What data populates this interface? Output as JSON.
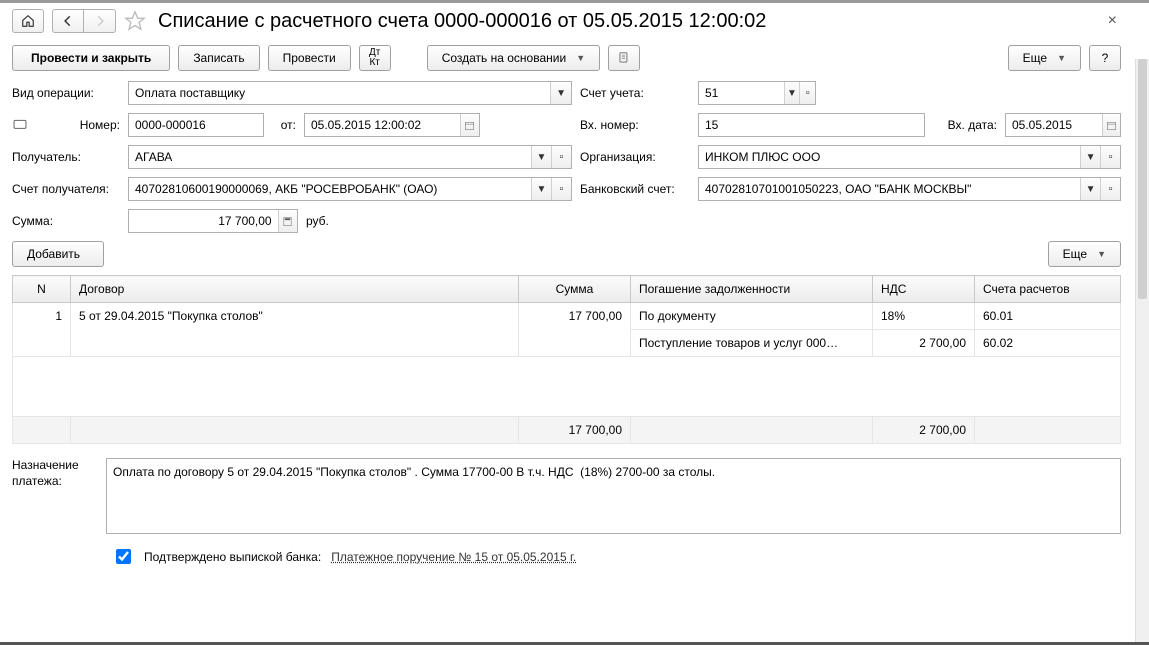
{
  "title": "Списание с расчетного счета 0000-000016 от 05.05.2015 12:00:02",
  "toolbar": {
    "post_close": "Провести и закрыть",
    "save": "Записать",
    "post": "Провести",
    "create_based": "Создать на основании",
    "more": "Еще"
  },
  "labels": {
    "op_type": "Вид операции:",
    "number": "Номер:",
    "from": "от:",
    "account": "Счет учета:",
    "in_number": "Вх. номер:",
    "in_date": "Вх. дата:",
    "payee": "Получатель:",
    "org": "Организация:",
    "payee_acc": "Счет получателя:",
    "bank_acc": "Банковский счет:",
    "amount": "Сумма:",
    "currency": "руб.",
    "add": "Добавить",
    "purpose": "Назначение платежа:",
    "confirmed": "Подтверждено выпиской банка:"
  },
  "fields": {
    "op_type": "Оплата поставщику",
    "number": "0000-000016",
    "date": "05.05.2015 12:00:02",
    "account": "51",
    "in_number": "15",
    "in_date": "05.05.2015",
    "payee": "АГАВА",
    "org": "ИНКОМ ПЛЮС ООО",
    "payee_acc": "40702810600190000069, АКБ \"РОСЕВРОБАНК\" (ОАО)",
    "bank_acc": "40702810701001050223, ОАО \"БАНК МОСКВЫ\"",
    "amount": "17 700,00",
    "purpose": "Оплата по договору 5 от 29.04.2015 \"Покупка столов\" . Сумма 17700-00 В т.ч. НДС  (18%) 2700-00 за столы."
  },
  "table": {
    "headers": {
      "n": "N",
      "contract": "Договор",
      "sum": "Сумма",
      "debt": "Погашение задолженности",
      "vat": "НДС",
      "settle": "Счета расчетов"
    },
    "row": {
      "n": "1",
      "contract": "5 от 29.04.2015 \"Покупка столов\"",
      "sum": "17 700,00",
      "debt1": "По документу",
      "debt2": "Поступление товаров и услуг 000…",
      "vat1": "18%",
      "vat2": "2 700,00",
      "acc1": "60.01",
      "acc2": "60.02"
    },
    "footer": {
      "sum": "17 700,00",
      "vat": "2 700,00"
    }
  },
  "link": "Платежное поручение № 15 от 05.05.2015 г."
}
